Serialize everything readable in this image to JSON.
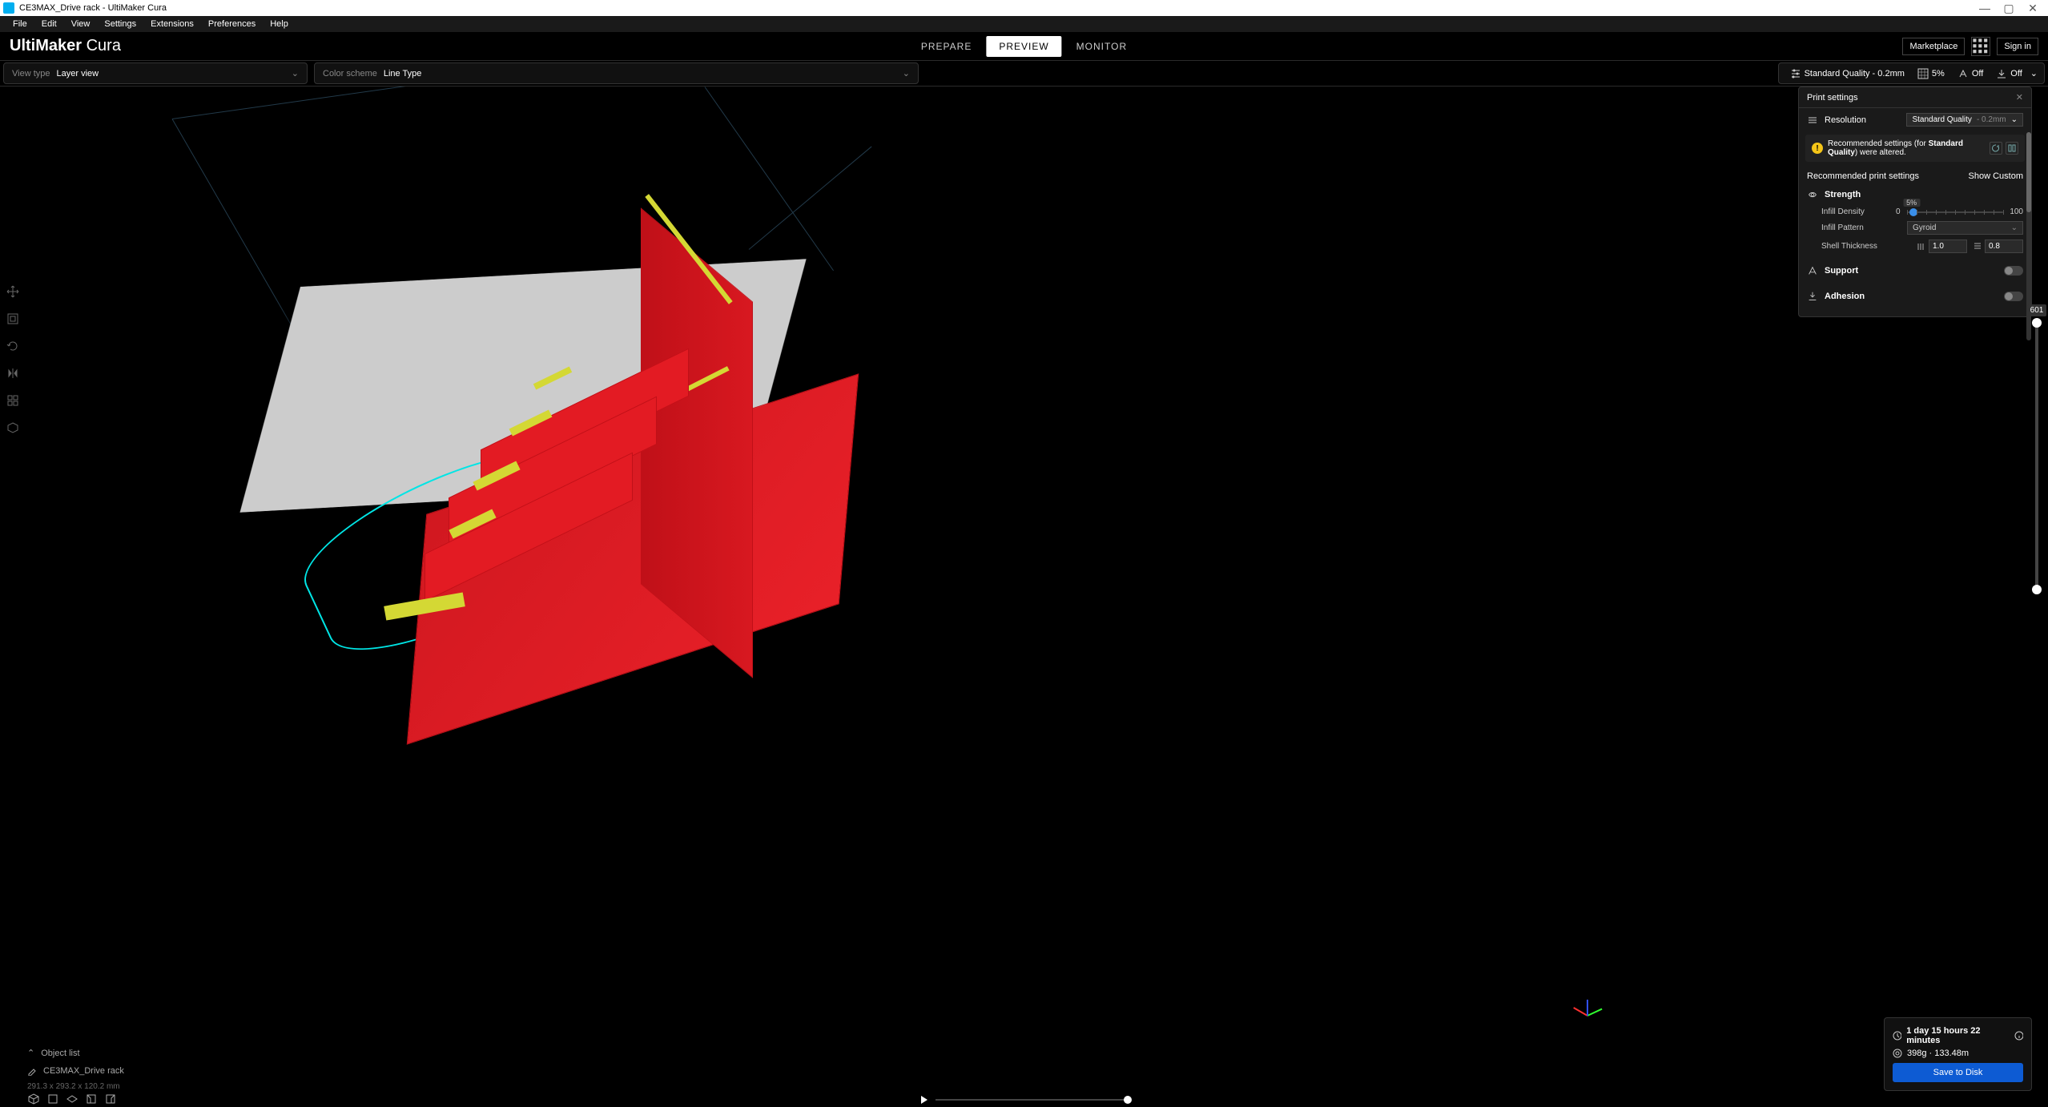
{
  "window": {
    "title": "CE3MAX_Drive rack - UltiMaker Cura"
  },
  "menus": [
    "File",
    "Edit",
    "View",
    "Settings",
    "Extensions",
    "Preferences",
    "Help"
  ],
  "logo": {
    "bold": "UltiMaker",
    "thin": " Cura"
  },
  "stages": {
    "prepare": "PREPARE",
    "preview": "PREVIEW",
    "monitor": "MONITOR"
  },
  "header": {
    "marketplace": "Marketplace",
    "signin": "Sign in"
  },
  "viewbar": {
    "viewtype_label": "View type",
    "viewtype_value": "Layer view",
    "colorscheme_label": "Color scheme",
    "colorscheme_value": "Line Type"
  },
  "summary": {
    "profile": "Standard Quality - 0.2mm",
    "infill": "5%",
    "support": "Off",
    "adhesion": "Off"
  },
  "panel": {
    "title": "Print settings",
    "resolution_label": "Resolution",
    "resolution_value": "Standard Quality",
    "resolution_sub": " - 0.2mm",
    "alert_prefix": "Recommended settings (for ",
    "alert_bold": "Standard Quality",
    "alert_suffix": ") were altered.",
    "recommended_label": "Recommended print settings",
    "show_custom": "Show Custom",
    "strength_label": "Strength",
    "infill_density_label": "Infill Density",
    "infill_density_value": "5%",
    "slider_min": "0",
    "slider_max": "100",
    "infill_pattern_label": "Infill Pattern",
    "infill_pattern_value": "Gyroid",
    "shell_label": "Shell Thickness",
    "shell_h": "1.0",
    "shell_v": "0.8",
    "support_label": "Support",
    "adhesion_label": "Adhesion"
  },
  "rightslider": {
    "top_layer": "601"
  },
  "objectlist": {
    "title": "Object list",
    "item": "CE3MAX_Drive rack",
    "dims": "291.3 x 293.2 x 120.2 mm"
  },
  "slicecard": {
    "time": "1 day 15 hours 22 minutes",
    "material": "398g · 133.48m",
    "save": "Save to Disk"
  }
}
